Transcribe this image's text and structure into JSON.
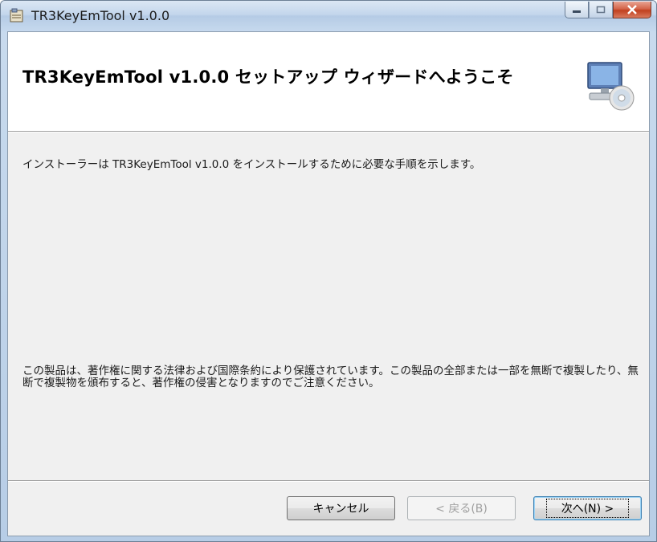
{
  "window": {
    "title": "TR3KeyEmTool v1.0.0"
  },
  "banner": {
    "title": "TR3KeyEmTool v1.0.0 セットアップ ウィザードへようこそ"
  },
  "content": {
    "intro": "インストーラーは TR3KeyEmTool v1.0.0 をインストールするために必要な手順を示します。",
    "notice": "この製品は、著作権に関する法律および国際条約により保護されています。この製品の全部または一部を無断で複製したり、無断で複製物を頒布すると、著作権の侵害となりますのでご注意ください。"
  },
  "buttons": {
    "cancel": "キャンセル",
    "back": "< 戻る(B)",
    "next": "次へ(N) >"
  },
  "colors": {
    "close_button": "#c1401f",
    "client_background": "#f0f0f0"
  }
}
